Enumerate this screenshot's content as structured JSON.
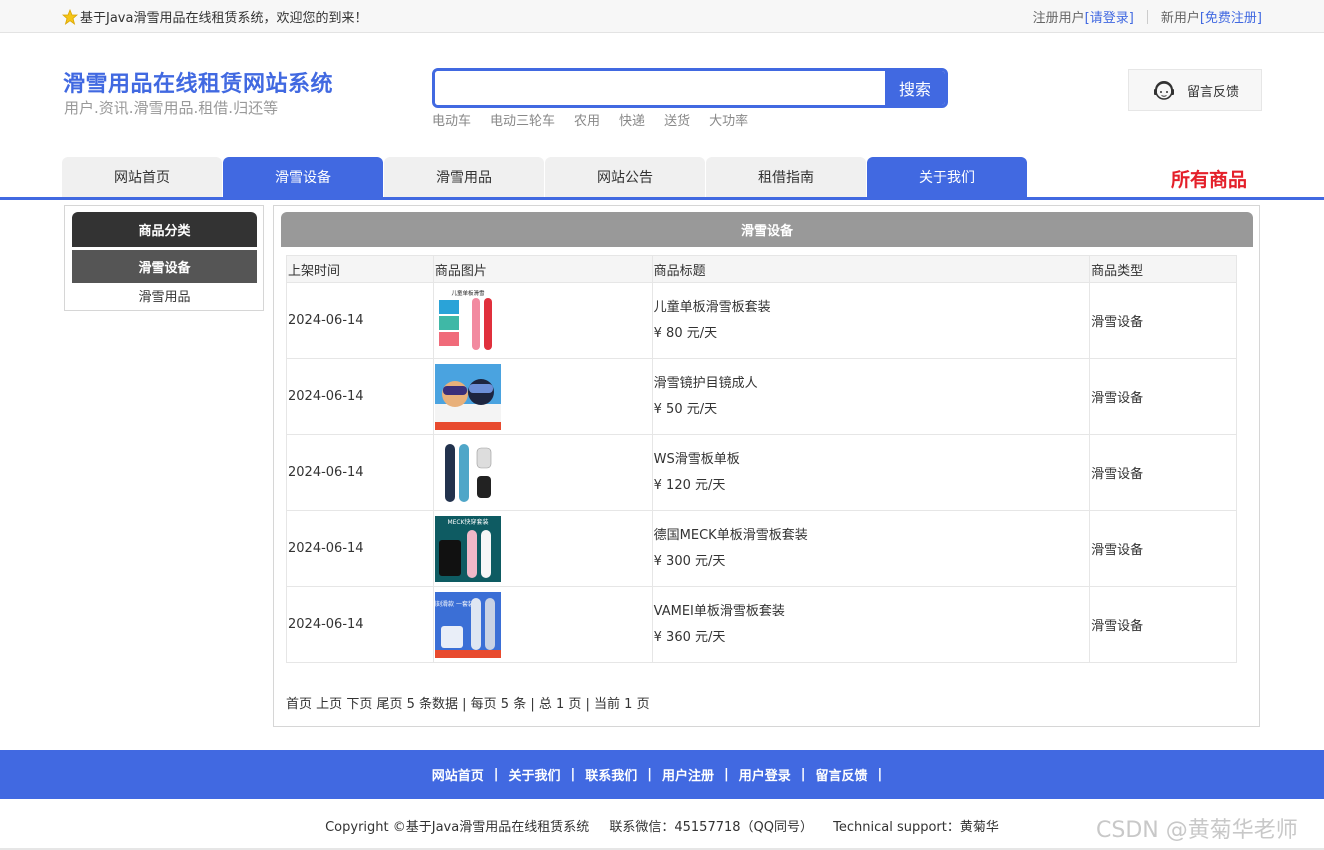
{
  "topbar": {
    "welcome": "基于Java滑雪用品在线租赁系统，欢迎您的到来！",
    "register_user_label": "注册用户",
    "login_link": "[请登录]",
    "new_user_label": "新用户",
    "signup_link": "[免费注册]"
  },
  "header": {
    "site_title": "滑雪用品在线租赁网站系统",
    "site_subtitle": "用户.资讯.滑雪用品.租借.归还等",
    "search_button": "搜索",
    "search_value": "",
    "hot_words": [
      "电动车",
      "电动三轮车",
      "农用",
      "快递",
      "送货",
      "大功率"
    ],
    "feedback_label": "留言反馈"
  },
  "nav": {
    "tabs": [
      {
        "label": "网站首页",
        "active": false
      },
      {
        "label": "滑雪设备",
        "active": true
      },
      {
        "label": "滑雪用品",
        "active": false
      },
      {
        "label": "网站公告",
        "active": false
      },
      {
        "label": "租借指南",
        "active": false
      },
      {
        "label": "关于我们",
        "active": true
      }
    ],
    "all_goods": "所有商品"
  },
  "sidebar": {
    "heading": "商品分类",
    "items": [
      {
        "label": "滑雪设备",
        "active": true
      },
      {
        "label": "滑雪用品",
        "active": false
      }
    ]
  },
  "main": {
    "heading": "滑雪设备",
    "columns": [
      "上架时间",
      "商品图片",
      "商品标题",
      "商品类型"
    ],
    "rows": [
      {
        "date": "2024-06-14",
        "title": "儿童单板滑雪板套装",
        "price": "¥ 80 元/天",
        "type": "滑雪设备",
        "image_caption": "儿童单板滑雪"
      },
      {
        "date": "2024-06-14",
        "title": "滑雪镜护目镜成人",
        "price": "¥ 50 元/天",
        "type": "滑雪设备",
        "image_caption": ""
      },
      {
        "date": "2024-06-14",
        "title": "WS滑雪板单板",
        "price": "¥ 120 元/天",
        "type": "滑雪设备",
        "image_caption": ""
      },
      {
        "date": "2024-06-14",
        "title": "德国MECK单板滑雪板套装",
        "price": "¥ 300 元/天",
        "type": "滑雪设备",
        "image_caption": "MECK快穿套装"
      },
      {
        "date": "2024-06-14",
        "title": "VAMEI单板滑雪板套装",
        "price": "¥ 360 元/天",
        "type": "滑雪设备",
        "image_caption": "入门刻滑款 一套装够"
      }
    ],
    "pager": {
      "first": "首页",
      "prev": "上页",
      "next": "下页",
      "last": "尾页",
      "summary": "5 条数据 | 每页 5 条 | 总 1 页 | 当前 1 页"
    }
  },
  "footer": {
    "links": [
      "网站首页",
      "关于我们",
      "联系我们",
      "用户注册",
      "用户登录",
      "留言反馈"
    ],
    "copyright": "Copyright ©基于Java滑雪用品在线租赁系统",
    "contact": "联系微信：45157718（QQ同号）",
    "support": "Technical support：黄菊华",
    "watermark": "CSDN @黄菊华老师"
  },
  "colors": {
    "brand_blue": "#4169e1",
    "accent_red": "#e4202a",
    "dark_gray": "#333333"
  },
  "icons": {
    "welcome": "star-icon",
    "feedback": "headset-icon"
  }
}
